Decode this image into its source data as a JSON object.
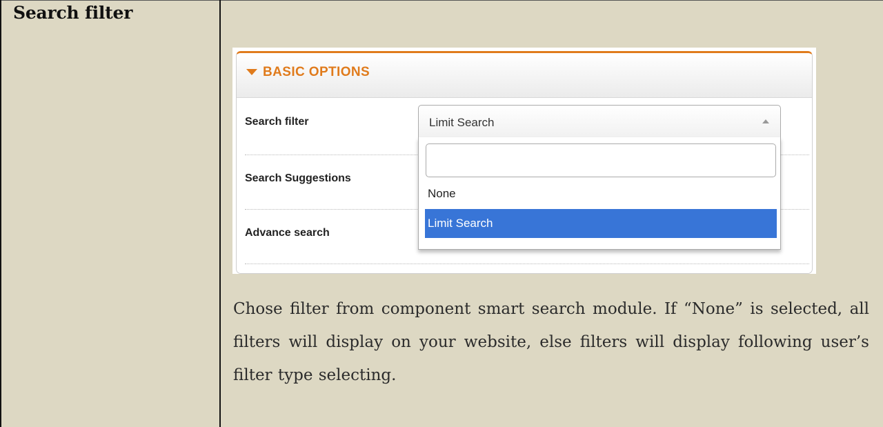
{
  "row": {
    "label": "Search filter"
  },
  "panel": {
    "title": "BASIC OPTIONS",
    "fields": [
      {
        "label": "Search filter"
      },
      {
        "label": "Search Suggestions"
      },
      {
        "label": "Advance search"
      }
    ],
    "select": {
      "value": "Limit Search",
      "search_value": "",
      "options": [
        "None",
        "Limit Search"
      ],
      "selected": "Limit Search"
    },
    "colors": {
      "accent": "#e07b1c",
      "highlight": "#3875d7"
    }
  },
  "description": "Chose filter from component smart search module. If “None” is selected, all filters will display on your website, else filters will display following user’s filter type selecting."
}
